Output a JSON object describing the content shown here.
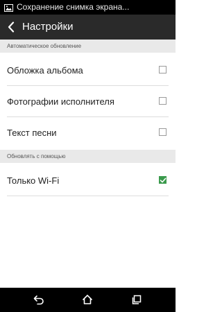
{
  "status_bar": {
    "notification_icon": "image-icon",
    "text": "Сохранение снимка экрана..."
  },
  "action_bar": {
    "back_icon": "chevron-left-icon",
    "title": "Настройки"
  },
  "sections": [
    {
      "header": "Автоматическое обновление",
      "items": [
        {
          "label": "Обложка альбома",
          "checked": false
        },
        {
          "label": "Фотографии исполнителя",
          "checked": false
        },
        {
          "label": "Текст песни",
          "checked": false
        }
      ]
    },
    {
      "header": "Обновлять с помощью",
      "items": [
        {
          "label": "Только Wi-Fi",
          "checked": true
        }
      ]
    }
  ],
  "nav_bar": {
    "back_icon": "back-arrow-icon",
    "home_icon": "home-icon",
    "recents_icon": "recent-apps-icon"
  },
  "colors": {
    "accent": "#3a9a4c",
    "action_bar": "#2a2a2a",
    "section_header_bg": "#e9e9e9"
  }
}
